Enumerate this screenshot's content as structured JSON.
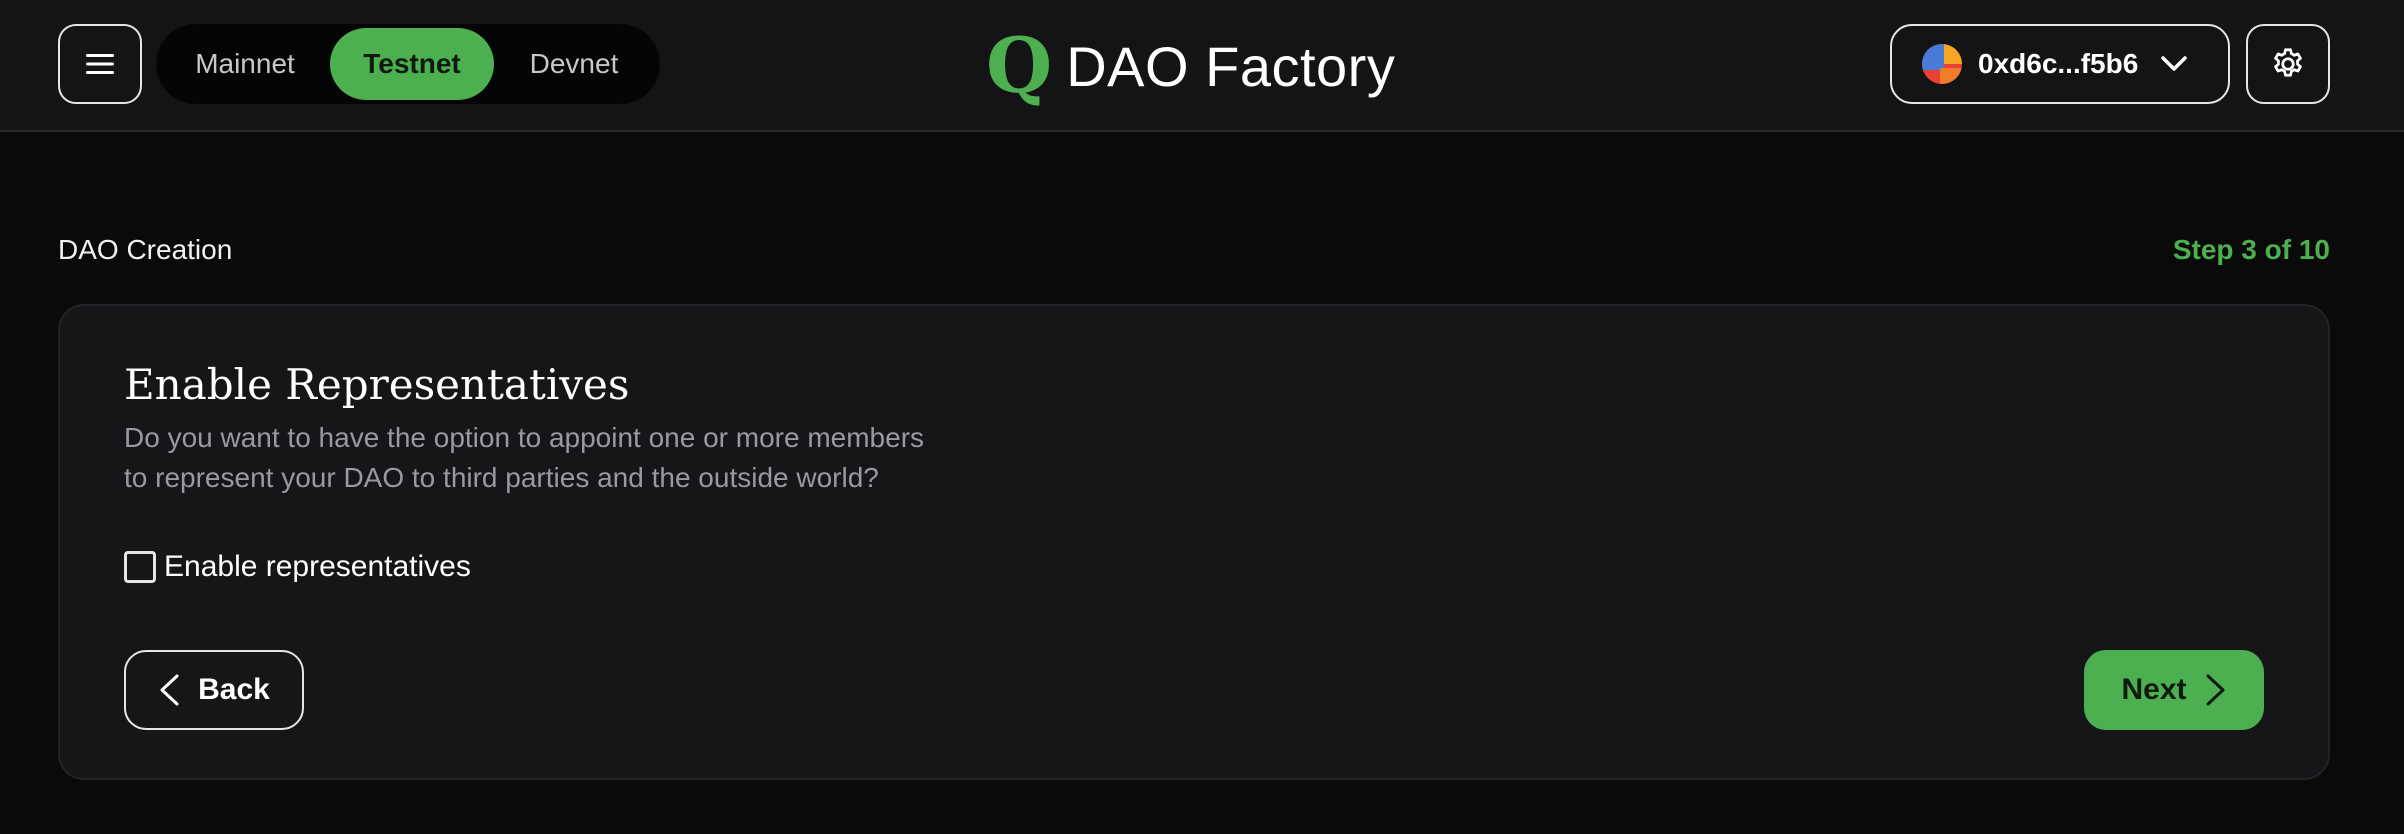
{
  "header": {
    "networks": [
      {
        "label": "Mainnet",
        "active": false
      },
      {
        "label": "Testnet",
        "active": true
      },
      {
        "label": "Devnet",
        "active": false
      }
    ],
    "brand_logo": "Q",
    "brand_title": "DAO Factory",
    "wallet_address": "0xd6c...f5b6",
    "icons": {
      "menu": "menu-icon",
      "wallet_avatar": "wallet-avatar-icon",
      "wallet_dropdown": "chevron-down-icon",
      "settings": "gear-icon"
    }
  },
  "page": {
    "breadcrumb": "DAO Creation",
    "step": "Step 3 of 10"
  },
  "card": {
    "title": "Enable Representatives",
    "description_line1": "Do you want to have the option to appoint one or more members",
    "description_line2": "to represent your DAO to third parties and the outside world?",
    "checkbox_label": "Enable representatives",
    "checkbox_checked": false,
    "back_label": "Back",
    "next_label": "Next"
  },
  "colors": {
    "accent": "#4caf50",
    "background": "#0a0a0b",
    "header": "#141416",
    "card": "#161618",
    "muted_text": "#9a9a9e"
  }
}
